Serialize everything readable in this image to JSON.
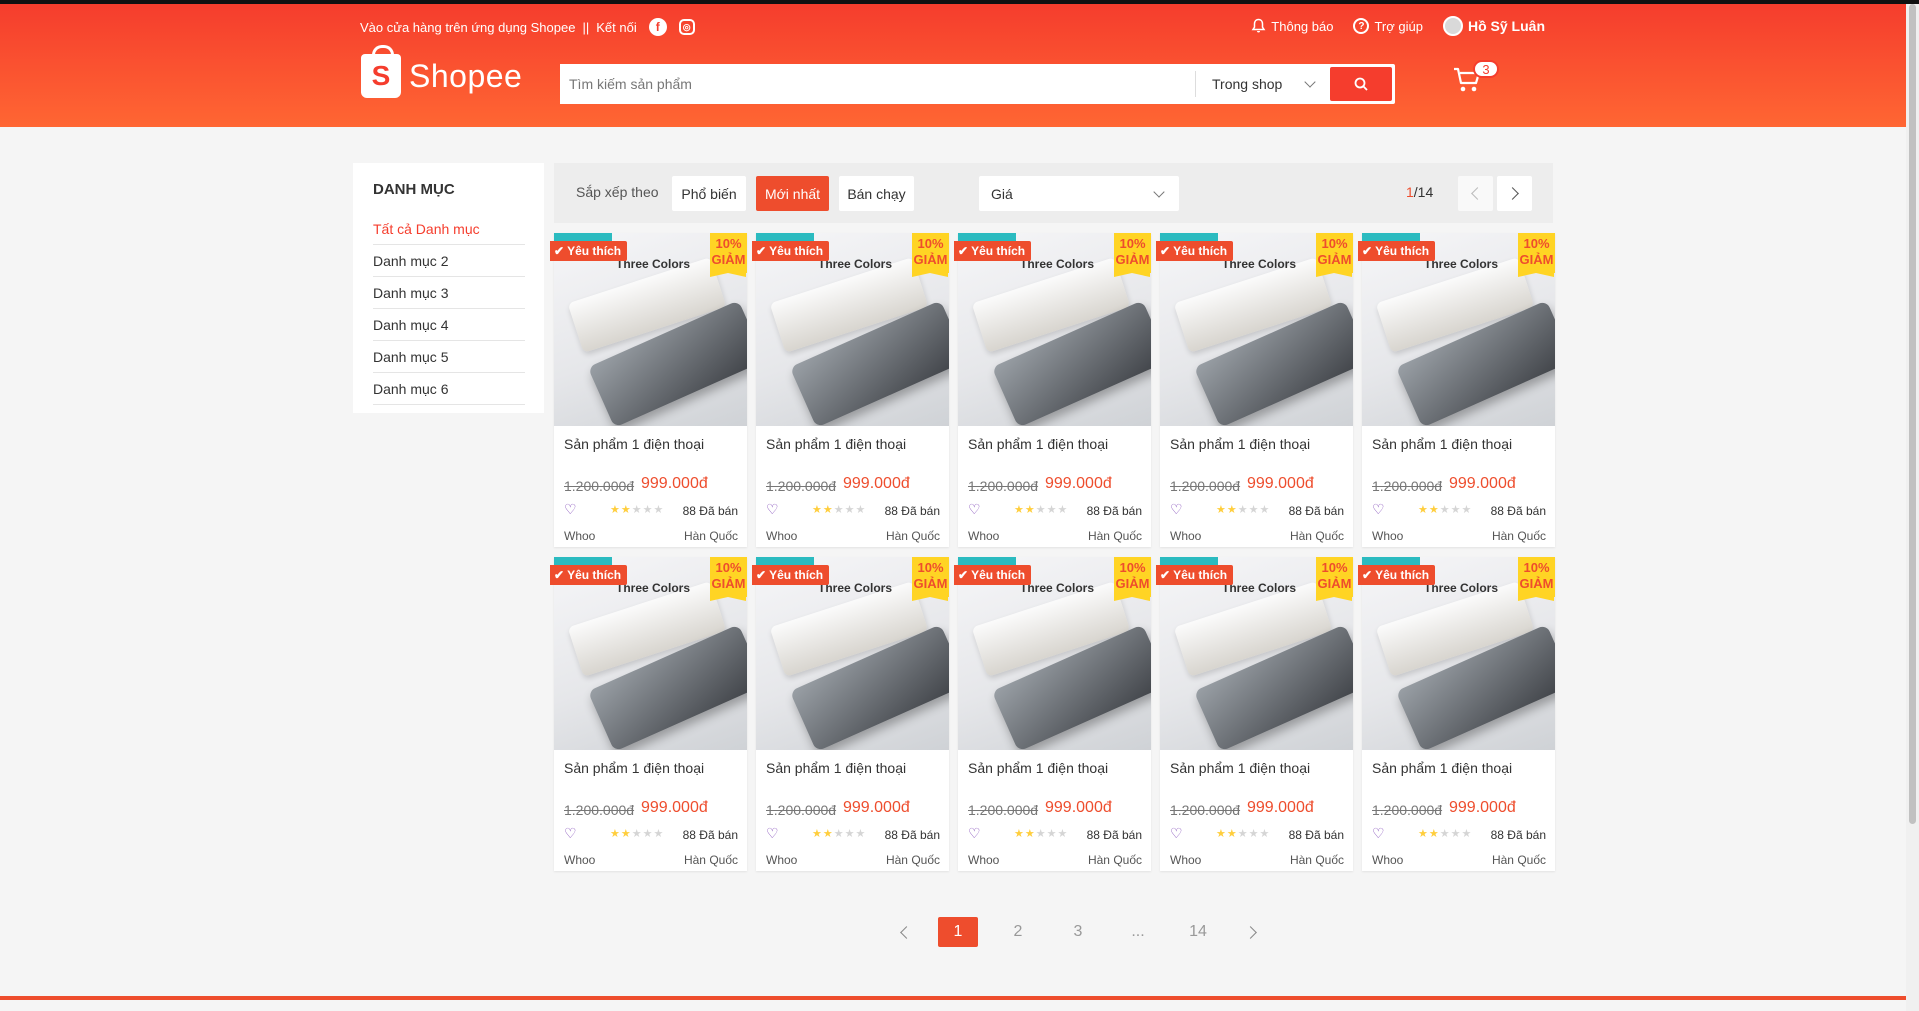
{
  "colors": {
    "brand": "#ee4d2d",
    "header": "#f53d2d",
    "discount": "#ffd424"
  },
  "topnav": {
    "download_text": "Vào cửa hàng trên ứng dụng Shopee",
    "separator": "||",
    "connect_text": "Kết nối",
    "notification": "Thông báo",
    "help": "Trợ giúp",
    "user_name": "Hồ Sỹ Luân"
  },
  "logo": {
    "text": "Shopee",
    "icon": "S"
  },
  "search": {
    "placeholder": "Tìm kiếm sản phẩm",
    "value": "",
    "scope": "Trong shop",
    "icon": "search-icon"
  },
  "cart": {
    "count": "3",
    "icon": "cart-icon"
  },
  "sidebar": {
    "title": "DANH MỤC",
    "items": [
      "Tất cả Danh mục",
      "Danh mục 2",
      "Danh mục 3",
      "Danh mục 4",
      "Danh mục 5",
      "Danh mục 6"
    ],
    "active": 0
  },
  "sortbar": {
    "label": "Sắp xếp theo",
    "options": [
      "Phổ biến",
      "Mới nhất",
      "Bán chạy"
    ],
    "selected": 1,
    "price_label": "Giá",
    "page_current": "1",
    "page_total": "/14"
  },
  "product_template": {
    "favorite_label": "Yêu thích",
    "discount_pct": "10%",
    "discount_word": "GIẢM",
    "image_caption": "Three Colors",
    "name": "Sản phẩm 1 điện thoại",
    "old_price": "1.200.000đ",
    "new_price": "999.000đ",
    "rating": 2,
    "max_rating": 5,
    "sold": "88 Đã bán",
    "brand": "Whoo",
    "origin": "Hàn Quốc"
  },
  "product_count": 10,
  "pagination": {
    "pages": [
      "1",
      "2",
      "3",
      "...",
      "14"
    ],
    "current": 0
  }
}
